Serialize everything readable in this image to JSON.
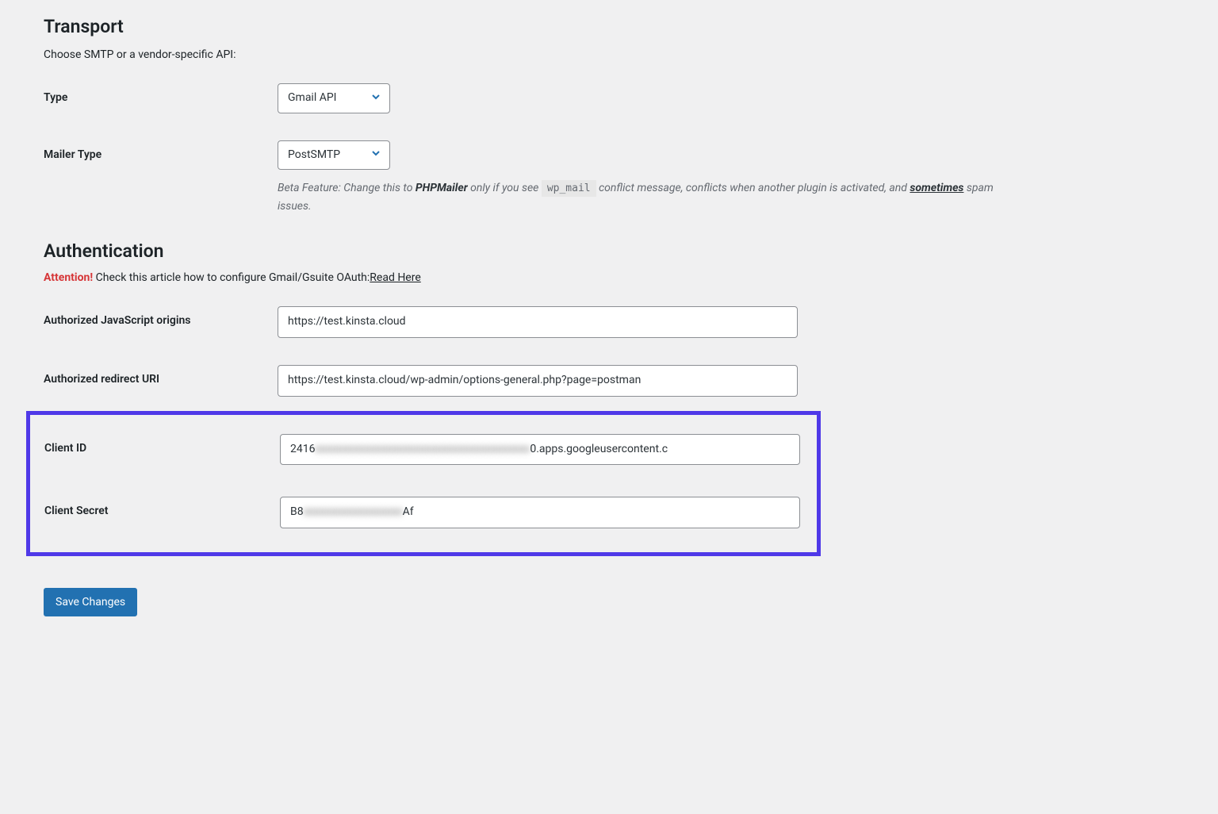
{
  "transport": {
    "heading": "Transport",
    "description": "Choose SMTP or a vendor-specific API:",
    "type": {
      "label": "Type",
      "value": "Gmail API"
    },
    "mailer_type": {
      "label": "Mailer Type",
      "value": "PostSMTP",
      "description_prefix": "Beta Feature: Change this to ",
      "description_bold": "PHPMailer",
      "description_mid": " only if you see ",
      "description_code": "wp_mail",
      "description_mid2": " conflict message, conflicts when another plugin is activated, and ",
      "description_underline": "sometimes",
      "description_suffix": " spam issues."
    }
  },
  "authentication": {
    "heading": "Authentication",
    "attention_label": "Attention!",
    "attention_text": " Check this article how to configure Gmail/Gsuite OAuth:",
    "attention_link": "Read Here",
    "js_origins": {
      "label": "Authorized JavaScript origins",
      "value": "https://test.kinsta.cloud"
    },
    "redirect_uri": {
      "label": "Authorized redirect URI",
      "value": "https://test.kinsta.cloud/wp-admin/options-general.php?page=postman"
    },
    "client_id": {
      "label": "Client ID",
      "value_prefix": "2416",
      "value_blurred": "xxxxxxxxxxxxxxxxxxxxxxxxxxxxxxxxxxxxxxx",
      "value_suffix": "0.apps.googleusercontent.c"
    },
    "client_secret": {
      "label": "Client Secret",
      "value_prefix": "B8",
      "value_blurred": "xxxxxxxxxxxxxxxxxx",
      "value_suffix": "Af"
    }
  },
  "save_button": "Save Changes"
}
